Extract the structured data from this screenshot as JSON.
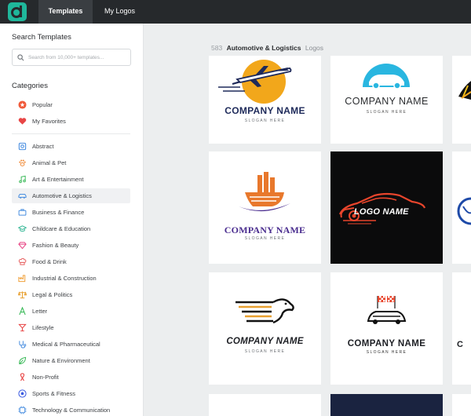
{
  "topbar": {
    "tabs": [
      {
        "label": "Templates",
        "active": true
      },
      {
        "label": "My Logos",
        "active": false
      }
    ]
  },
  "sidebar": {
    "search_heading": "Search Templates",
    "search_placeholder": "Search from 10,000+ templates...",
    "categories_heading": "Categories",
    "pinned": [
      {
        "label": "Popular",
        "icon": "star-badge-icon",
        "color": "#f05a3a"
      },
      {
        "label": "My Favorites",
        "icon": "heart-icon",
        "color": "#e84545"
      }
    ],
    "categories": [
      {
        "label": "Abstract",
        "icon": "abstract-shapes-icon",
        "color": "#4a8fe0"
      },
      {
        "label": "Animal & Pet",
        "icon": "paw-icon",
        "color": "#f08c3a"
      },
      {
        "label": "Art & Entertainment",
        "icon": "music-note-icon",
        "color": "#3cba5a"
      },
      {
        "label": "Automotive & Logistics",
        "icon": "car-icon",
        "color": "#4a8fe0",
        "active": true
      },
      {
        "label": "Business & Finance",
        "icon": "briefcase-icon",
        "color": "#4a8fe0"
      },
      {
        "label": "Childcare & Education",
        "icon": "graduation-cap-icon",
        "color": "#3cba9a"
      },
      {
        "label": "Fashion & Beauty",
        "icon": "diamond-icon",
        "color": "#e84585"
      },
      {
        "label": "Food & Drink",
        "icon": "chef-hat-icon",
        "color": "#e86565"
      },
      {
        "label": "Industrial & Construction",
        "icon": "factory-icon",
        "color": "#f0a03a"
      },
      {
        "label": "Legal & Politics",
        "icon": "scales-icon",
        "color": "#e8a030"
      },
      {
        "label": "Letter",
        "icon": "letter-a-icon",
        "color": "#3cba5a"
      },
      {
        "label": "Lifestyle",
        "icon": "cocktail-icon",
        "color": "#e84545"
      },
      {
        "label": "Medical & Pharmaceutical",
        "icon": "stethoscope-icon",
        "color": "#4a8fe0"
      },
      {
        "label": "Nature & Environment",
        "icon": "leaf-icon",
        "color": "#3cba5a"
      },
      {
        "label": "Non-Profit",
        "icon": "ribbon-icon",
        "color": "#e84545"
      },
      {
        "label": "Sports & Fitness",
        "icon": "soccer-ball-icon",
        "color": "#3a5ae0"
      },
      {
        "label": "Technology & Communication",
        "icon": "chip-icon",
        "color": "#4a8fe0"
      }
    ]
  },
  "main": {
    "results": {
      "count": "583",
      "category": "Automotive & Logistics",
      "suffix": "Logos"
    },
    "cards": [
      {
        "company": "COMPANY NAME",
        "slogan": "SLOGAN HERE",
        "art": "airplane-sun-logo"
      },
      {
        "company": "COMPANY NAME",
        "slogan": "SLOGAN HERE",
        "art": "car-circle-logo"
      },
      {
        "company": "",
        "slogan": "",
        "art": "road-logo-partial"
      },
      {
        "company": "COMPANY NAME",
        "slogan": "SLOGAN HERE",
        "art": "cargo-ship-logo"
      },
      {
        "company": "LOGO NAME",
        "slogan": "",
        "art": "sports-car-logo"
      },
      {
        "company": "",
        "slogan": "",
        "art": "globe-logo-partial"
      },
      {
        "company": "COMPANY NAME",
        "slogan": "SLOGAN HERE",
        "art": "speed-eagle-logo"
      },
      {
        "company": "COMPANY NAME",
        "slogan": "SLOGAN HERE",
        "art": "racing-flags-car-logo"
      },
      {
        "company": "C",
        "slogan": "",
        "art": "partial-logo"
      }
    ],
    "colors": {
      "accent": "#4a8fe0",
      "orange": "#f2a71b",
      "navy": "#1e2a5a",
      "teal": "#29b6e0",
      "purple": "#4a2d8f",
      "red": "#e8452c"
    }
  }
}
